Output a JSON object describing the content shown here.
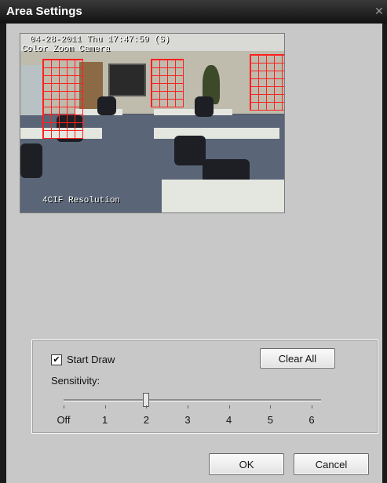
{
  "window": {
    "title": "Area Settings",
    "close_glyph": "✕"
  },
  "camera": {
    "timestamp": "04-28-2011 Thu 17:47:59 (S)",
    "camera_name": "Color Zoom Camera",
    "resolution": "4CIF Resolution"
  },
  "controls": {
    "start_draw_label": "Start Draw",
    "start_draw_checked": true,
    "check_glyph": "✔",
    "clear_all_label": "Clear All",
    "sensitivity_label": "Sensitivity:",
    "sensitivity_ticks": [
      "Off",
      "1",
      "2",
      "3",
      "4",
      "5",
      "6"
    ],
    "sensitivity_value": "2"
  },
  "footer": {
    "ok_label": "OK",
    "cancel_label": "Cancel"
  }
}
